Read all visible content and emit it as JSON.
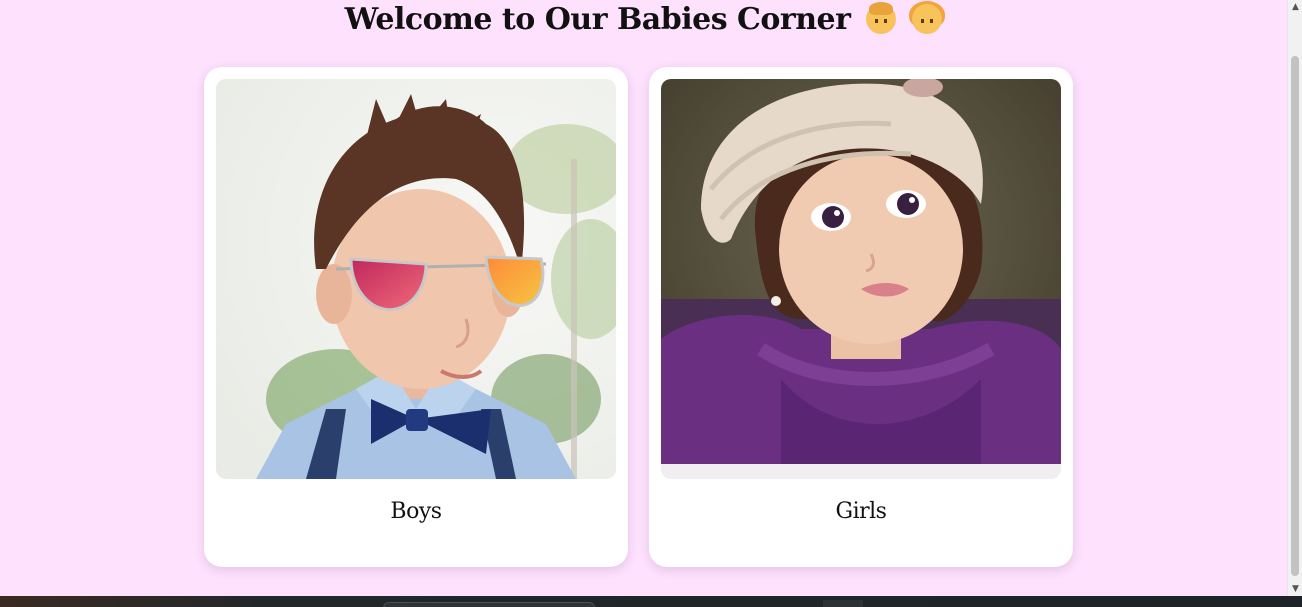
{
  "header": {
    "title": "Welcome to Our Babies Corner",
    "emojis": [
      "baby-boy-emoji",
      "baby-girl-emoji"
    ]
  },
  "cards": [
    {
      "caption": "Boys",
      "image": "boy-photo"
    },
    {
      "caption": "Girls",
      "image": "girl-photo"
    }
  ],
  "colors": {
    "background": "#fde1fd",
    "card": "#ffffff",
    "text": "#111111"
  }
}
